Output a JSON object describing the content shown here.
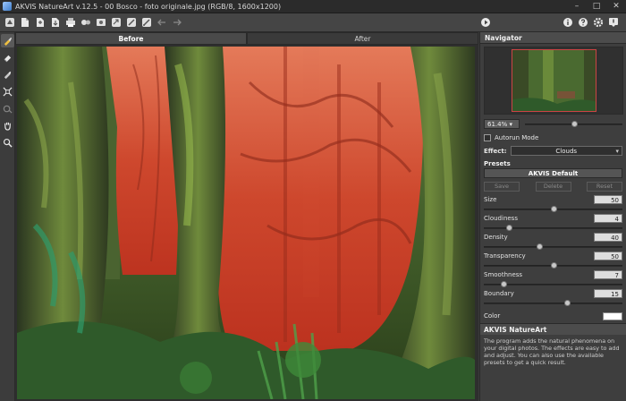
{
  "window": {
    "title": "AKVIS NatureArt v.12.5 - 00 Bosco - foto originale.jpg (RGB/8, 1600x1200)",
    "minimize": "–",
    "maximize": "□",
    "close": "✕"
  },
  "toolbar": {
    "left_icons": [
      "home-icon",
      "open-icon",
      "save-icon",
      "export-icon",
      "print-icon",
      "batch-icon",
      "plugin-icon",
      "share-icon",
      "settings-icon",
      "preferences-icon",
      "undo-icon",
      "redo-icon"
    ],
    "right_icons": [
      "run-icon",
      "info-icon",
      "help-icon",
      "gear-icon",
      "notifications-icon"
    ]
  },
  "left_tools": [
    "brush-icon",
    "eraser-icon",
    "highlight-icon",
    "crop-icon",
    "stamp-icon",
    "hand-icon",
    "zoom-icon"
  ],
  "tabs": {
    "before": "Before",
    "after": "After"
  },
  "navigator": {
    "title": "Navigator",
    "zoom": "61.4%",
    "zoom_arrow": "▾",
    "zoom_level": 0.5
  },
  "autorun": {
    "label": "Autorun Mode",
    "checked": false
  },
  "effect": {
    "label": "Effect:",
    "value": "Clouds",
    "arrow": "▾"
  },
  "presets": {
    "title": "Presets",
    "current": "AKVIS Default",
    "save": "Save",
    "delete": "Delete",
    "reset": "Reset"
  },
  "params": [
    {
      "name": "Size",
      "value": "50",
      "level": 0.5
    },
    {
      "name": "Cloudiness",
      "value": "4",
      "level": 0.18
    },
    {
      "name": "Density",
      "value": "40",
      "level": 0.4
    },
    {
      "name": "Transparency",
      "value": "50",
      "level": 0.5
    },
    {
      "name": "Smoothness",
      "value": "7",
      "level": 0.14
    },
    {
      "name": "Boundary",
      "value": "15",
      "level": 0.6
    }
  ],
  "color": {
    "label": "Color",
    "value": "#ffffff"
  },
  "help": {
    "title": "AKVIS NatureArt",
    "text": "The program adds the natural phenomena on your digital photos. The effects are easy to add and adjust. You can also use the available presets to get a quick result."
  },
  "colors": {
    "mask_red": "#e8321e",
    "accent": "#4c4c4c"
  }
}
